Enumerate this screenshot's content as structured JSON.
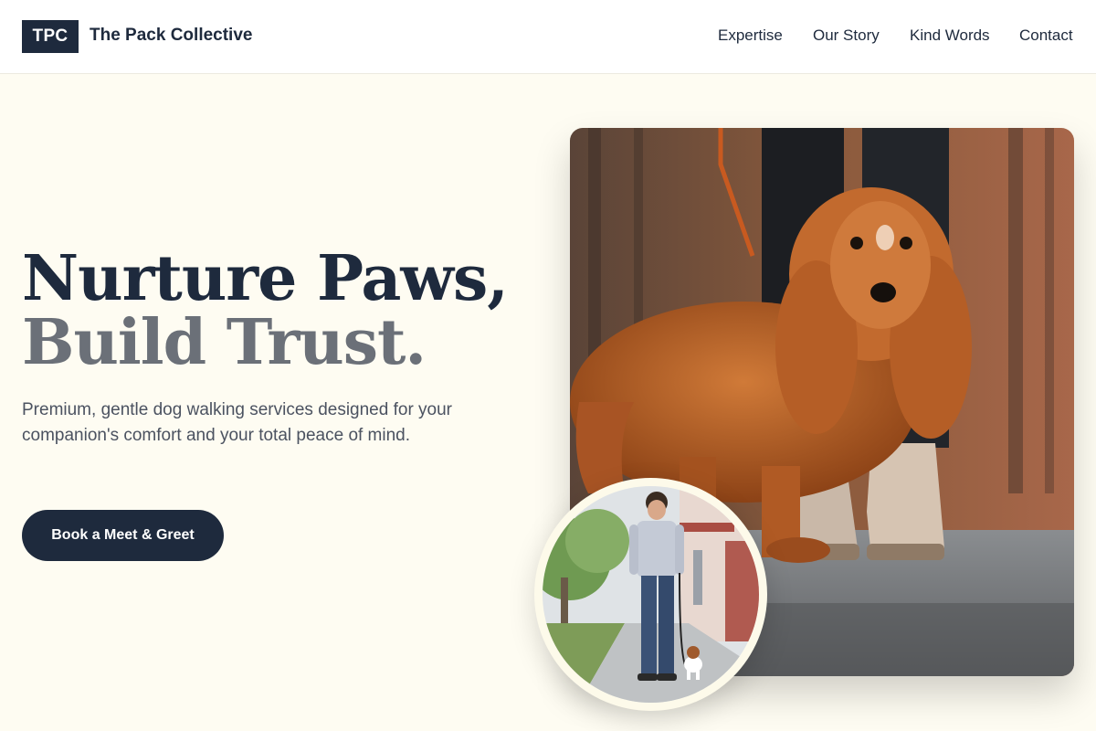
{
  "header": {
    "logo_text": "TPC",
    "brand_name": "The Pack Collective",
    "nav": [
      {
        "label": "Expertise"
      },
      {
        "label": "Our Story"
      },
      {
        "label": "Kind Words"
      },
      {
        "label": "Contact"
      }
    ]
  },
  "hero": {
    "headline_line1": "Nurture Paws,",
    "headline_line2": "Build Trust.",
    "subtext": "Premium, gentle dog walking services designed for your companion's comfort and your total peace of mind.",
    "cta_label": "Book a Meet & Greet"
  },
  "images": {
    "main_photo": "cocker-spaniel-on-leash-photo",
    "inset_photo": "man-walking-small-dog-photo"
  },
  "colors": {
    "primary": "#1e2a3d",
    "secondary_text": "#6b7078",
    "page_background": "#fefcf2"
  }
}
